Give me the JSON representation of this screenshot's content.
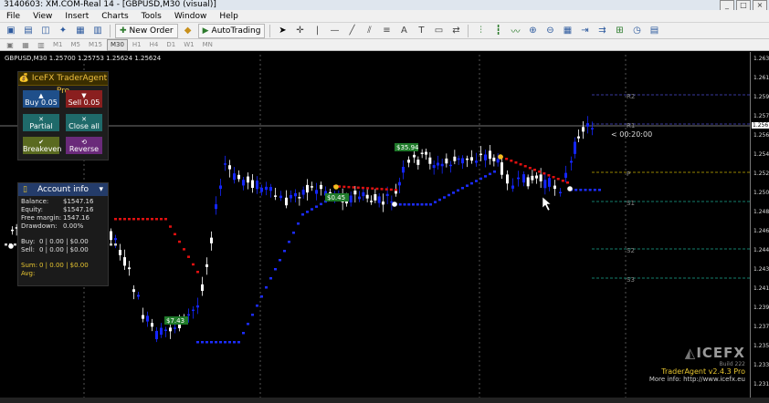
{
  "window": {
    "title": "3140603: XM.COM-Real 14 - [GBPUSD,M30 (visual)]"
  },
  "menu": [
    "File",
    "View",
    "Insert",
    "Charts",
    "Tools",
    "Window",
    "Help"
  ],
  "toolbar": {
    "new_order": "New Order",
    "autotrading": "AutoTrading"
  },
  "timeframes": [
    "M1",
    "M5",
    "M15",
    "M30",
    "H1",
    "H4",
    "D1",
    "W1",
    "MN"
  ],
  "active_timeframe": "M30",
  "chart": {
    "symbol_header": "GBPUSD,M30  1.25700 1.25753 1.25624 1.25624",
    "price_labels": [
      "1.263",
      "1.261",
      "1.259",
      "1.257",
      "1.256",
      "1.254",
      "1.252",
      "1.250",
      "1.248",
      "1.246",
      "1.244",
      "1.243",
      "1.241",
      "1.239",
      "1.237",
      "1.235",
      "1.233",
      "1.231"
    ],
    "current_price": "1.256",
    "countdown": "< 00:20:00",
    "levels": [
      "R2",
      "R1",
      "P",
      "S1",
      "S2",
      "S3"
    ],
    "profit_tags": [
      "$35.94",
      "$0.45",
      "$7.43"
    ],
    "colors": {
      "bull": "#1426ff",
      "bear": "#ffffff",
      "trail_up": "#1c2cff",
      "trail_down": "#e01010",
      "pivot": "#c8b000",
      "resistance": "#4a4ad0",
      "support": "#1aa88e",
      "background": "#000000",
      "trade_tag": "#1f7a2a"
    }
  },
  "trade_panel": {
    "title": "IceFX TraderAgent Pro",
    "buy": "Buy 0.05",
    "sell": "Sell 0.05",
    "partial": "Partial",
    "close_all": "Close all",
    "breakeven": "Breakeven",
    "reverse": "Reverse"
  },
  "account": {
    "title": "Account info",
    "rows": [
      {
        "label": "Balance:",
        "value": "$1547.16"
      },
      {
        "label": "Equity:",
        "value": "$1547.16"
      },
      {
        "label": "Free margin:",
        "value": "1547.16"
      },
      {
        "label": "Drawdown:",
        "value": "0.00%"
      }
    ],
    "buy": {
      "label": "Buy:",
      "value": "0 | 0.00 | $0.00"
    },
    "sell": {
      "label": "Sell:",
      "value": "0 | 0.00 | $0.00"
    },
    "sum": {
      "label": "Sum:",
      "value": "0 | 0.00 | $0.00"
    },
    "avg": {
      "label": "Avg:",
      "value": ""
    }
  },
  "branding": {
    "logo": "ICEFX",
    "build": "Build 222",
    "version": "TraderAgent v2.4.3 Pro",
    "more_info": "More info: http://www.icefx.eu"
  }
}
